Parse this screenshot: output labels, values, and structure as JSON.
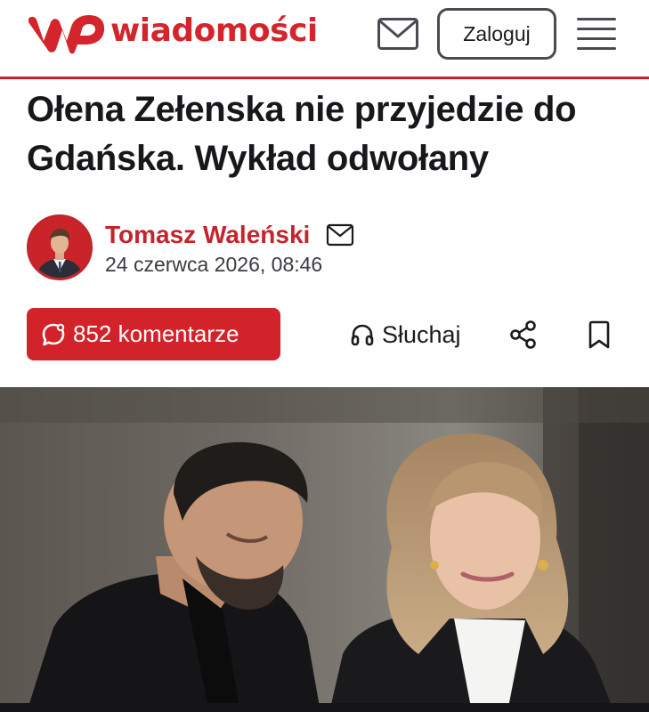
{
  "header": {
    "logo_text": "wiadomości",
    "login_label": "Zaloguj",
    "accent_color": "#c4242b"
  },
  "icons": {
    "logo": "wp-logo",
    "mail": "envelope-icon",
    "menu": "hamburger-menu-icon",
    "author_mail": "envelope-icon",
    "comments": "comment-bubble-icon",
    "listen": "headphones-icon",
    "share": "share-icon",
    "bookmark": "bookmark-icon"
  },
  "article": {
    "title": "Ołena Zełenska nie przyjedzie do Gdańska. Wykład odwołany",
    "author": "Tomasz Waleński",
    "date": "24 czerwca 2026, 08:46"
  },
  "actions": {
    "comments_label": "852 komentarze",
    "listen_label": "Słuchaj"
  }
}
